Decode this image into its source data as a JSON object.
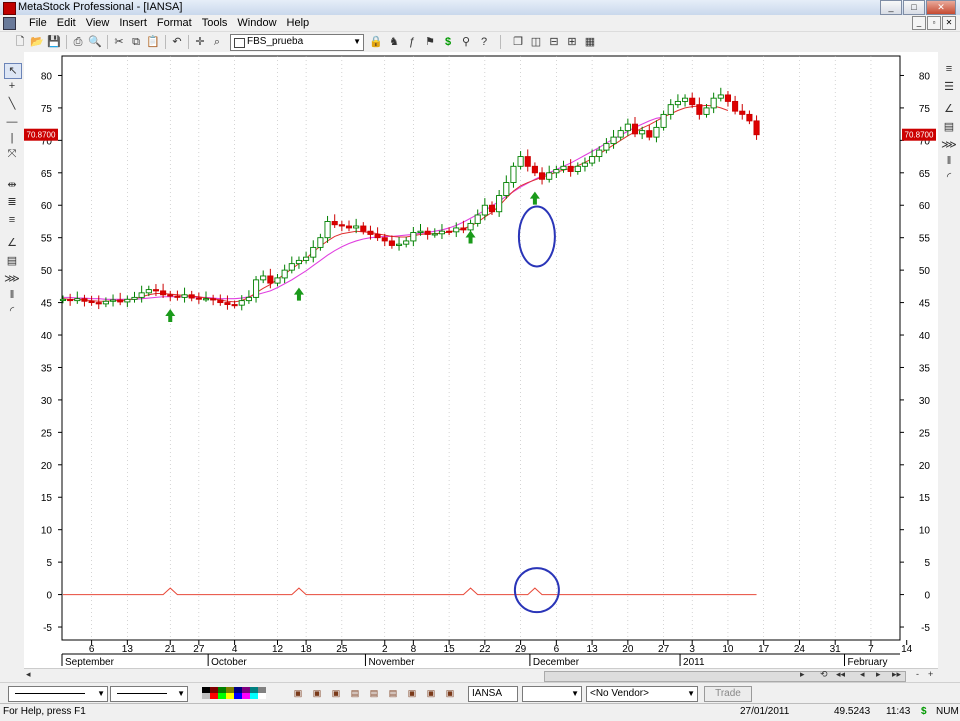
{
  "window": {
    "title": "MetaStock Professional - [IANSA]",
    "min_glyph": "_",
    "max_glyph": "□",
    "close_glyph": "✕"
  },
  "menu": [
    "File",
    "Edit",
    "View",
    "Insert",
    "Format",
    "Tools",
    "Window",
    "Help"
  ],
  "toolbar": {
    "security_name": "FBS_prueba"
  },
  "chart": {
    "y_ticks": [
      80,
      75,
      70,
      65,
      60,
      55,
      50,
      45,
      40,
      35,
      30,
      25,
      20,
      15,
      10,
      5,
      0,
      -5
    ],
    "last_price_label": "70.8700",
    "last_price": 70.87,
    "day_labels": [
      {
        "label": "6",
        "day": 4
      },
      {
        "label": "13",
        "day": 9
      },
      {
        "label": "21",
        "day": 15
      },
      {
        "label": "27",
        "day": 19
      },
      {
        "label": "4",
        "day": 24
      },
      {
        "label": "12",
        "day": 30
      },
      {
        "label": "18",
        "day": 34
      },
      {
        "label": "25",
        "day": 39
      },
      {
        "label": "2",
        "day": 45
      },
      {
        "label": "8",
        "day": 49
      },
      {
        "label": "15",
        "day": 54
      },
      {
        "label": "22",
        "day": 59
      },
      {
        "label": "29",
        "day": 64
      },
      {
        "label": "6",
        "day": 69
      },
      {
        "label": "13",
        "day": 74
      },
      {
        "label": "20",
        "day": 79
      },
      {
        "label": "27",
        "day": 84
      },
      {
        "label": "3",
        "day": 88
      },
      {
        "label": "10",
        "day": 93
      },
      {
        "label": "17",
        "day": 98
      },
      {
        "label": "24",
        "day": 103
      },
      {
        "label": "31",
        "day": 108
      },
      {
        "label": "7",
        "day": 113
      },
      {
        "label": "14",
        "day": 118
      }
    ],
    "month_labels": [
      {
        "label": "September",
        "day": 0
      },
      {
        "label": "October",
        "day": 21
      },
      {
        "label": "November",
        "day": 43
      },
      {
        "label": "December",
        "day": 66
      },
      {
        "label": "2011",
        "day": 87
      },
      {
        "label": "February",
        "day": 110
      }
    ]
  },
  "chart_data": {
    "type": "candlestick",
    "ylim": [
      -7,
      83
    ],
    "x_unit": "trading day index (0 = first visible bar, early September 2010)",
    "closes": [
      45.5,
      45.3,
      45.6,
      45.2,
      45.0,
      44.8,
      45.2,
      45.4,
      45.1,
      45.5,
      45.8,
      46.5,
      47.0,
      46.8,
      46.2,
      46.0,
      45.8,
      46.2,
      45.7,
      45.6,
      45.6,
      45.4,
      45.0,
      44.7,
      44.6,
      45.3,
      45.8,
      48.5,
      49.1,
      48.0,
      48.8,
      50.0,
      51.0,
      51.5,
      52.0,
      53.5,
      55.0,
      57.5,
      57.0,
      56.8,
      56.5,
      56.8,
      56.0,
      55.5,
      55.0,
      54.5,
      53.8,
      54.0,
      54.5,
      55.8,
      56.0,
      55.5,
      55.6,
      56.0,
      55.9,
      56.5,
      56.2,
      57.2,
      58.5,
      60.0,
      59.0,
      61.5,
      63.5,
      66.0,
      67.5,
      66.0,
      65.0,
      64.0,
      65.0,
      65.5,
      66.0,
      65.2,
      66.0,
      66.5,
      67.5,
      68.5,
      69.5,
      70.5,
      71.5,
      72.5,
      71.0,
      71.5,
      70.5,
      72.0,
      74.0,
      75.5,
      76.0,
      76.5,
      75.5,
      74.0,
      75.0,
      76.5,
      77.0,
      76.0,
      74.5,
      74.0,
      73.0,
      70.87
    ],
    "ma_short": [
      45.6,
      45.5,
      45.5,
      45.4,
      45.3,
      45.2,
      45.2,
      45.3,
      45.3,
      45.4,
      45.6,
      45.9,
      46.2,
      46.4,
      46.4,
      46.3,
      46.2,
      46.1,
      46.0,
      45.9,
      45.7,
      45.6,
      45.4,
      45.2,
      45.1,
      45.3,
      45.8,
      46.5,
      47.2,
      47.8,
      48.6,
      49.4,
      50.2,
      51.0,
      51.8,
      52.8,
      53.7,
      54.5,
      55.2,
      55.6,
      55.8,
      56.0,
      55.9,
      55.8,
      55.6,
      55.4,
      55.2,
      55.1,
      55.1,
      55.3,
      55.5,
      55.6,
      55.6,
      55.7,
      55.9,
      56.1,
      56.4,
      56.8,
      57.4,
      58.2,
      58.9,
      59.9,
      61.1,
      62.2,
      63.0,
      63.5,
      63.9,
      64.3,
      64.7,
      65.1,
      65.4,
      65.7,
      66.1,
      66.6,
      67.2,
      67.9,
      68.6,
      69.3,
      70.0,
      70.7,
      71.3,
      71.9,
      72.4,
      73.0,
      73.6,
      74.1,
      74.6,
      75.0,
      75.2,
      75.3,
      75.4,
      75.3,
      75.0,
      74.6
    ],
    "ma_long": [
      45.8,
      45.8,
      45.7,
      45.7,
      45.6,
      45.6,
      45.5,
      45.5,
      45.5,
      45.5,
      45.5,
      45.6,
      45.7,
      45.8,
      45.9,
      45.9,
      45.9,
      45.9,
      45.9,
      45.8,
      45.8,
      45.7,
      45.6,
      45.6,
      45.6,
      45.7,
      45.9,
      46.2,
      46.5,
      46.8,
      47.3,
      47.9,
      48.5,
      49.2,
      49.9,
      50.7,
      51.5,
      52.3,
      53.0,
      53.6,
      54.1,
      54.5,
      54.8,
      55.0,
      55.1,
      55.2,
      55.2,
      55.3,
      55.4,
      55.5,
      55.7,
      55.8,
      56.0,
      56.2,
      56.5,
      56.9,
      57.4,
      58.0,
      58.6,
      59.2,
      59.9,
      60.6,
      61.4,
      62.1,
      62.8,
      63.4,
      64.0,
      64.5,
      65.0,
      65.5,
      66.0,
      66.5,
      67.1,
      67.7,
      68.3,
      68.9,
      69.6,
      70.2,
      70.8,
      71.4,
      72.0,
      72.5,
      73.0,
      73.4,
      73.6
    ],
    "ma_long_start_day": 0,
    "signal_arrows_days": [
      15,
      33,
      57,
      66
    ],
    "indicator": {
      "baseline": 0,
      "pulse_days": [
        15,
        33,
        57,
        66
      ],
      "pulse_height": 1
    },
    "annotations": [
      {
        "shape": "ellipse",
        "target": "price",
        "day": 66,
        "value": 55.5
      },
      {
        "shape": "ellipse",
        "target": "indicator",
        "day": 66,
        "value": 1
      }
    ]
  },
  "bottom": {
    "symbol": "IANSA",
    "vendor": "<No Vendor>",
    "trade_label": "Trade",
    "palette": [
      "#000000",
      "#800000",
      "#008000",
      "#808000",
      "#000080",
      "#800080",
      "#008080",
      "#808080",
      "#c0c0c0",
      "#ff0000",
      "#00ff00",
      "#ffff00",
      "#0000ff",
      "#ff00ff",
      "#00ffff",
      "#ffffff"
    ]
  },
  "status": {
    "help": "For Help, press F1",
    "date": "27/01/2011",
    "value": "49.5243",
    "time": "11:43",
    "currency": "$",
    "num": "NUM"
  }
}
